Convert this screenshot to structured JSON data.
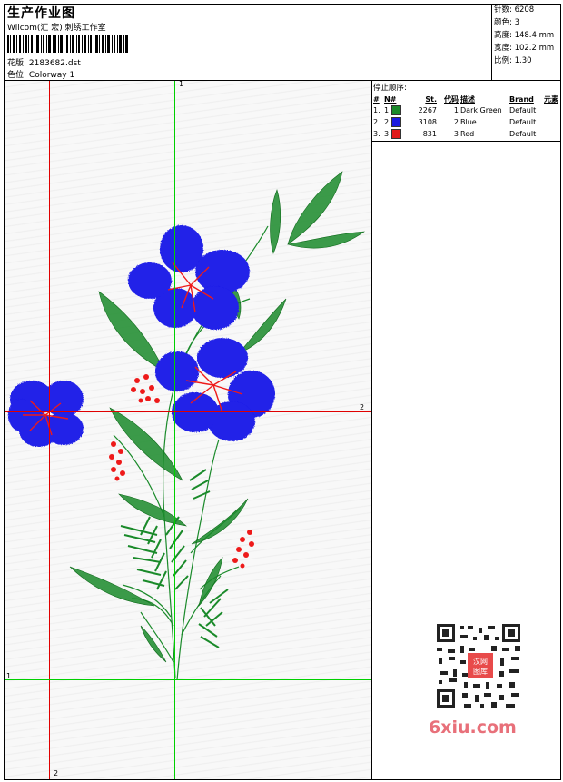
{
  "header": {
    "title": "生产作业图",
    "company": "Wilcom(汇 宏) 刺绣工作室",
    "design_label": "花版:",
    "design_value": "2183682.dst",
    "colorway_label": "色位:",
    "colorway_value": "Colorway 1"
  },
  "stats": [
    {
      "label": "针数:",
      "value": "6208"
    },
    {
      "label": "颜色:",
      "value": "3"
    },
    {
      "label": "高度:",
      "value": "148.4 mm"
    },
    {
      "label": "宽度:",
      "value": "102.2 mm"
    },
    {
      "label": "比例:",
      "value": "1.30"
    }
  ],
  "guides": {
    "v1_label": "1",
    "v2_label": "2",
    "h1_label": "1",
    "h2_label": "2"
  },
  "stop_sequence": {
    "title": "停止顺序:",
    "columns": [
      "#",
      "N#",
      "St.",
      "代码",
      "描述",
      "Brand",
      "元素"
    ],
    "rows": [
      {
        "num": "1.",
        "n": "1",
        "stitches": "2267",
        "code": "1",
        "description": "Dark Green",
        "brand": "Default",
        "element": "",
        "color": "#1a8a2a"
      },
      {
        "num": "2.",
        "n": "2",
        "stitches": "3108",
        "code": "2",
        "description": "Blue",
        "brand": "Default",
        "element": "",
        "color": "#1a1ae0"
      },
      {
        "num": "3.",
        "n": "3",
        "stitches": "831",
        "code": "3",
        "description": "Red",
        "brand": "Default",
        "element": "",
        "color": "#e01a1a"
      }
    ]
  },
  "watermark": {
    "qr_badge_text": "汉网图库",
    "site": "6xiu.com"
  },
  "colors": {
    "guide_green": "#00d000",
    "guide_red": "#e00000",
    "green": "#1a8a2a",
    "blue": "#2020e8",
    "red": "#ee1a1a"
  }
}
